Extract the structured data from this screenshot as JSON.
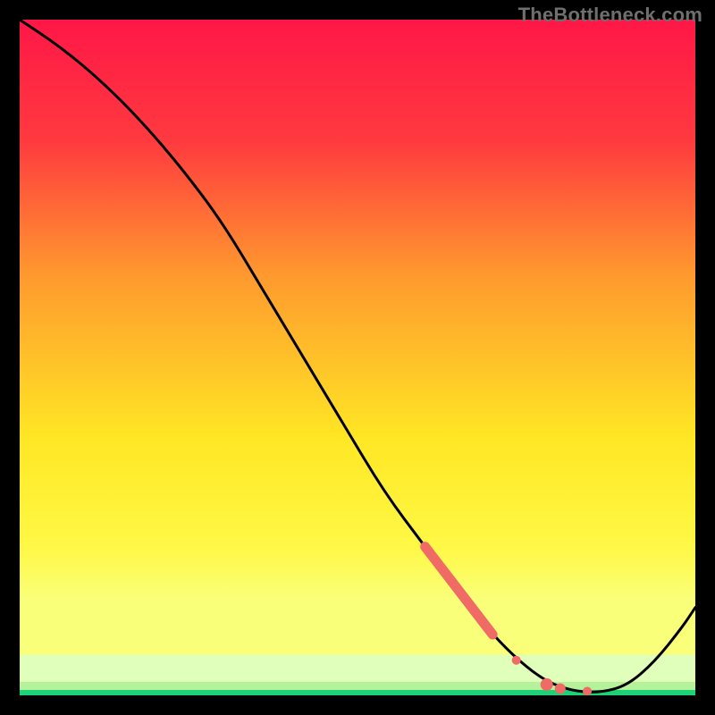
{
  "watermark": "TheBottleneck.com",
  "chart_data": {
    "type": "line",
    "title": "",
    "xlabel": "",
    "ylabel": "",
    "xlim": [
      0,
      100
    ],
    "ylim": [
      0,
      100
    ],
    "axes_visible": false,
    "legend": false,
    "background_gradient": {
      "top": "#ff1747",
      "mid_upper": "#ff9a2e",
      "mid": "#ffe724",
      "mid_lower": "#faff7a",
      "band_pale": "#d9ffc6",
      "bottom": "#1dd276"
    },
    "curve": {
      "description": "Bottleneck-percentage style curve: starts at top-left, descends almost linearly toward lower-right, reaches a flat minimum near x≈80-88, then rises again toward the right edge.",
      "x": [
        0,
        6,
        12,
        18,
        24,
        30,
        36,
        42,
        48,
        54,
        60,
        66,
        70,
        74,
        78,
        82,
        86,
        90,
        94,
        98,
        100
      ],
      "y": [
        100,
        96,
        91,
        85,
        78,
        70,
        60,
        50,
        40,
        30,
        22,
        14,
        9,
        5,
        2,
        0.6,
        0.4,
        1.5,
        5,
        10,
        13
      ]
    },
    "highlight_segments": [
      {
        "description": "thick salmon oblique segment on the descending part of the curve",
        "points": [
          {
            "x": 60,
            "y": 22
          },
          {
            "x": 70,
            "y": 9
          }
        ],
        "stroke": "#f06a66",
        "width": 11
      }
    ],
    "highlight_points": [
      {
        "x": 73.5,
        "y": 5.2,
        "r": 5,
        "fill": "#f06a66"
      },
      {
        "x": 78.0,
        "y": 1.6,
        "r": 7,
        "fill": "#f06a66"
      },
      {
        "x": 80.0,
        "y": 1.0,
        "r": 6,
        "fill": "#f06a66"
      },
      {
        "x": 84.0,
        "y": 0.6,
        "r": 5,
        "fill": "#f06a66"
      }
    ],
    "frame": {
      "border_color": "#000000",
      "border_width": 22
    }
  }
}
